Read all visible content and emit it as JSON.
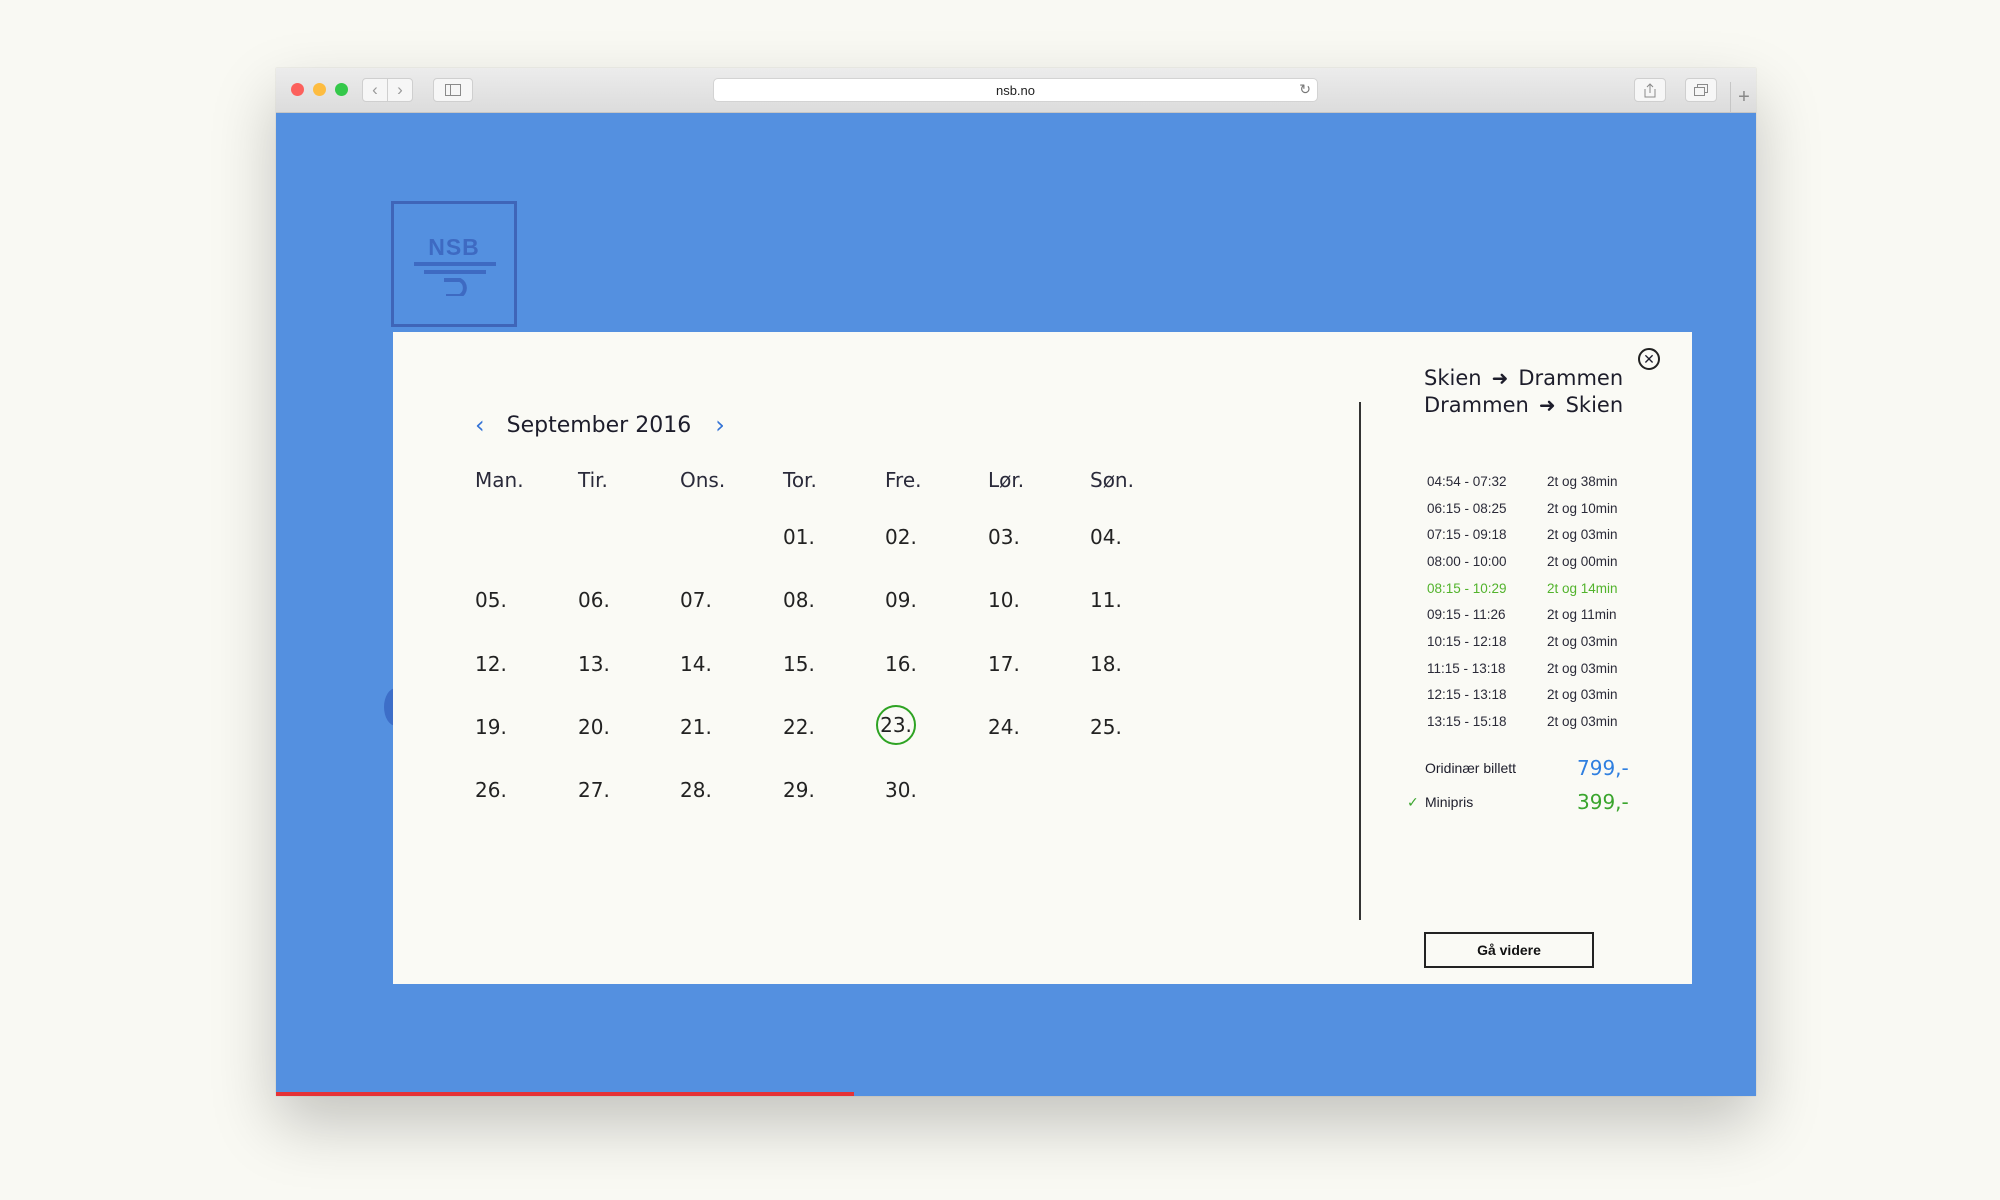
{
  "browser": {
    "url": "nsb.no"
  },
  "brand": {
    "logo_text": "NSB"
  },
  "calendar": {
    "month_label": "September 2016",
    "weekdays": [
      "Man.",
      "Tir.",
      "Ons.",
      "Tor.",
      "Fre.",
      "Lør.",
      "Søn."
    ],
    "weeks": [
      [
        "",
        "",
        "",
        "01.",
        "02.",
        "03.",
        "04."
      ],
      [
        "05.",
        "06.",
        "07.",
        "08.",
        "09.",
        "10.",
        "11."
      ],
      [
        "12.",
        "13.",
        "14.",
        "15.",
        "16.",
        "17.",
        "18."
      ],
      [
        "19.",
        "20.",
        "21.",
        "22.",
        "23.",
        "24.",
        "25."
      ],
      [
        "26.",
        "27.",
        "28.",
        "29.",
        "30.",
        "",
        ""
      ]
    ],
    "selected_day": "23."
  },
  "trip": {
    "outbound": {
      "from": "Skien",
      "to": "Drammen"
    },
    "return": {
      "from": "Drammen",
      "to": "Skien"
    },
    "departures": [
      {
        "time": "04:54 - 07:32",
        "duration": "2t og 38min",
        "selected": false
      },
      {
        "time": "06:15 - 08:25",
        "duration": "2t og 10min",
        "selected": false
      },
      {
        "time": "07:15 - 09:18",
        "duration": "2t og 03min",
        "selected": false
      },
      {
        "time": "08:00 - 10:00",
        "duration": "2t og 00min",
        "selected": false
      },
      {
        "time": "08:15 - 10:29",
        "duration": "2t og 14min",
        "selected": true
      },
      {
        "time": "09:15 - 11:26",
        "duration": "2t og 11min",
        "selected": false
      },
      {
        "time": "10:15 - 12:18",
        "duration": "2t og 03min",
        "selected": false
      },
      {
        "time": "11:15 - 13:18",
        "duration": "2t og 03min",
        "selected": false
      },
      {
        "time": "12:15 - 13:18",
        "duration": "2t og 03min",
        "selected": false
      },
      {
        "time": "13:15 - 15:18",
        "duration": "2t og 03min",
        "selected": false
      }
    ],
    "prices": [
      {
        "label": "Oridinær billett",
        "value": "799,-",
        "checked": false,
        "color": "#2f7fe0"
      },
      {
        "label": "Minipris",
        "value": "399,-",
        "checked": true,
        "color": "#3aa52d"
      }
    ],
    "cta_label": "Gå videre"
  },
  "colors": {
    "page_background": "#5490e0",
    "accent_green": "#3aa52d",
    "accent_blue": "#2f7fe0",
    "progress_red": "#e53236"
  }
}
